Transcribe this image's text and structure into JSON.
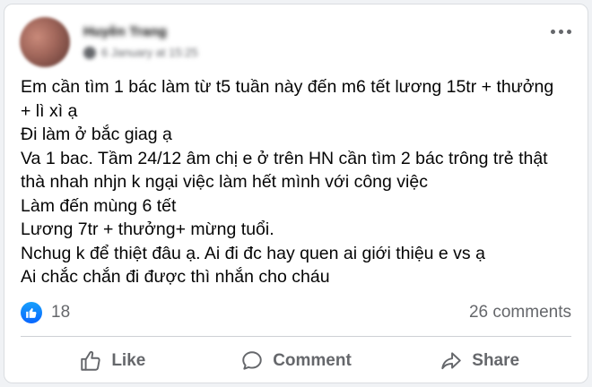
{
  "post": {
    "author": "Huyền Trang",
    "timestamp": "6 January at 15:25",
    "lines": [
      "Em cần tìm 1 bác làm từ t5 tuần này đến m6 tết lương 15tr + thưởng",
      "+ lì xì ạ",
      "Đi làm ở bắc giag ạ",
      "Va 1 bac. Tầm 24/12 âm chị e ở trên HN cần tìm 2 bác trông trẻ thật",
      "thà nhah nhjn k ngại việc làm hết mình với công việc",
      "Làm đến mùng 6 tết",
      "Lương 7tr + thưởng+ mừng tuổi.",
      "Nchug k để thiệt đâu ạ. Ai đi đc hay quen ai giới thiệu e vs ạ",
      "Ai chắc chắn đi được thì nhắn cho cháu"
    ]
  },
  "stats": {
    "reaction_count": "18",
    "comments": "26 comments"
  },
  "actions": {
    "like": "Like",
    "comment": "Comment",
    "share": "Share"
  },
  "colors": {
    "accent": "#0866ff",
    "secondary_text": "#65676b"
  },
  "icons": {
    "more": "more-options-icon",
    "like_reaction": "like-reaction-icon",
    "like": "thumbs-up-icon",
    "comment": "comment-bubble-icon",
    "share": "share-arrow-icon"
  }
}
